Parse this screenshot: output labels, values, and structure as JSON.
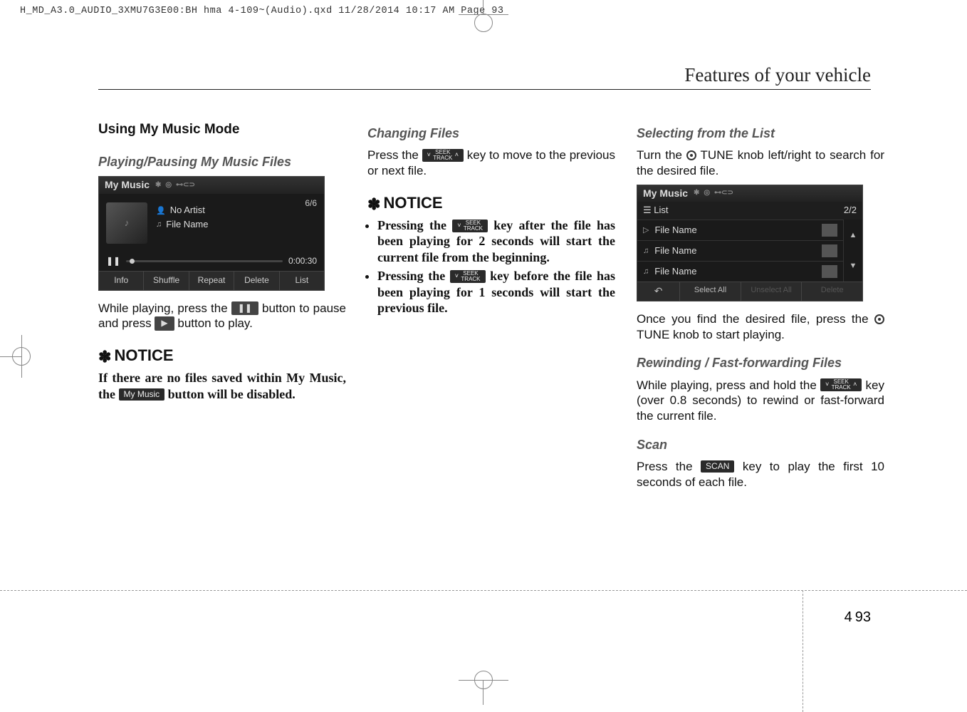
{
  "header_line": "H_MD_A3.0_AUDIO_3XMU7G3E00:BH hma 4-109~(Audio).qxd  11/28/2014  10:17 AM  Page 93",
  "page_title": "Features of your vehicle",
  "page_number": {
    "chapter": "4",
    "page": "93"
  },
  "col1": {
    "heading": "Using My Music Mode",
    "sub1": "Playing/Pausing My Music Files",
    "screen1": {
      "title": "My Music",
      "counter": "6/6",
      "artist": "No Artist",
      "file": "File Name",
      "time": "0:00:30",
      "buttons": [
        "Info",
        "Shuffle",
        "Repeat",
        "Delete",
        "List"
      ]
    },
    "para1a": "While playing, press the ",
    "para1b": " button to pause and press ",
    "para1c": " button to play.",
    "noticeLabel": "NOTICE",
    "notice1a": "If there are no files saved within My Music, the ",
    "notice1_btn": "My Music",
    "notice1b": " button will be disabled."
  },
  "col2": {
    "sub1": "Changing Files",
    "p1a": "Press the ",
    "p1b": " key to move to the previous or next file.",
    "noticeLabel": "NOTICE",
    "bul1a": "Pressing the ",
    "bul1b": " key after the file has been playing for 2 seconds will start the current file from the beginning.",
    "bul2a": "Pressing the ",
    "bul2b": " key before the file has been playing for 1 seconds will start the previous file.",
    "seek_top": "SEEK",
    "seek_bot": "TRACK"
  },
  "col3": {
    "sub1": "Selecting from the List",
    "p1a": "Turn the ",
    "p1b": "TUNE knob left/right to search for the desired file.",
    "screen2": {
      "title": "My Music",
      "list_label": "List",
      "counter": "2/2",
      "rows": [
        "File Name",
        "File Name",
        "File Name"
      ],
      "buttons": [
        "Select All",
        "Unselect All",
        "Delete"
      ]
    },
    "p2a": "Once you find the desired file, press the ",
    "p2b": "TUNE knob to start playing.",
    "sub2": "Rewinding / Fast-forwarding Files",
    "p3a": "While playing, press and hold the ",
    "p3b": " key (over 0.8 seconds) to rewind or fast-forward the current file.",
    "sub3": "Scan",
    "p4a": "Press the ",
    "scan_btn": "SCAN",
    "p4b": " key to play the first 10 seconds of each file."
  }
}
